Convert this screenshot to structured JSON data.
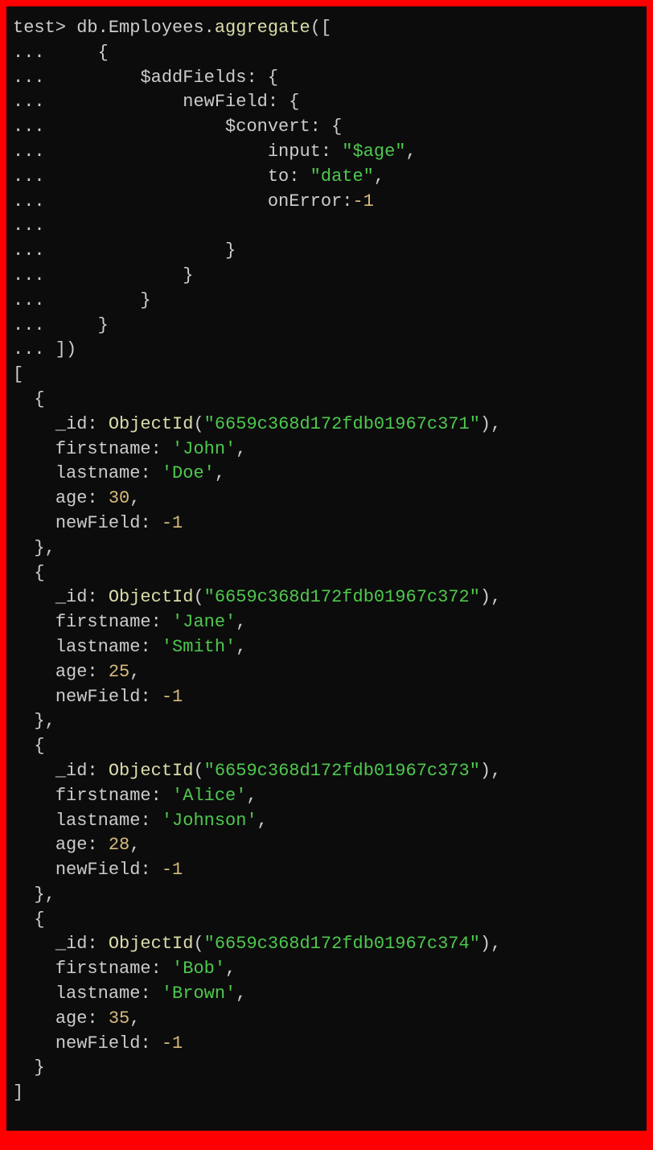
{
  "prompt": "test>",
  "cont": "...",
  "cmd": {
    "collection": "db.Employees",
    "method": "aggregate",
    "stage": "$addFields",
    "field": "newField",
    "operator": "$convert",
    "input_key": "input",
    "input_val": "\"$age\"",
    "to_key": "to",
    "to_val": "\"date\"",
    "onerror_key": "onError",
    "onerror_val": "-1"
  },
  "results": [
    {
      "id": "6659c368d172fdb01967c371",
      "firstname": "'John'",
      "lastname": "'Doe'",
      "age": "30",
      "newField": "-1"
    },
    {
      "id": "6659c368d172fdb01967c372",
      "firstname": "'Jane'",
      "lastname": "'Smith'",
      "age": "25",
      "newField": "-1"
    },
    {
      "id": "6659c368d172fdb01967c373",
      "firstname": "'Alice'",
      "lastname": "'Johnson'",
      "age": "28",
      "newField": "-1"
    },
    {
      "id": "6659c368d172fdb01967c374",
      "firstname": "'Bob'",
      "lastname": "'Brown'",
      "age": "35",
      "newField": "-1"
    }
  ],
  "labels": {
    "id": "_id",
    "objectid": "ObjectId",
    "firstname": "firstname",
    "lastname": "lastname",
    "age": "age",
    "newField": "newField"
  }
}
